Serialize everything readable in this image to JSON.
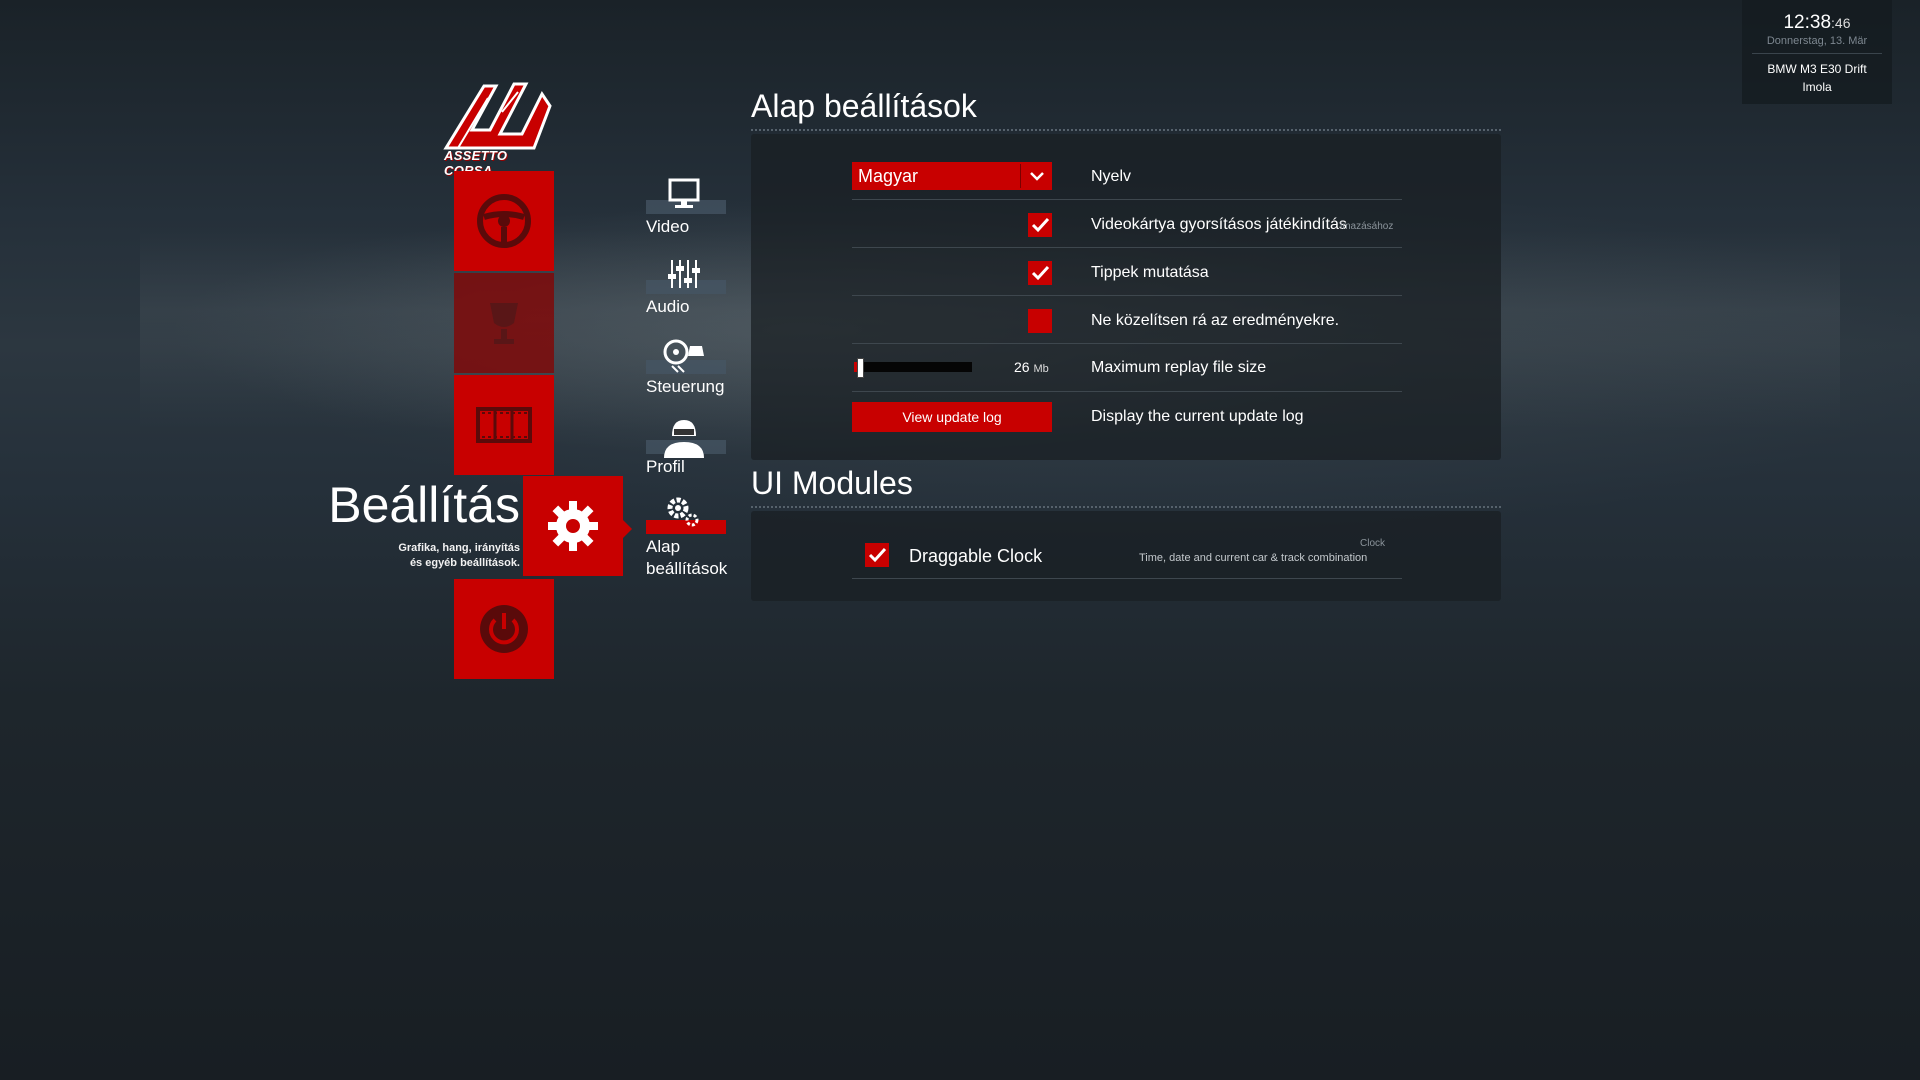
{
  "clock": {
    "time": "12:38",
    "seconds": ":46",
    "date": "Donnerstag, 13. Mär",
    "car": "BMW M3 E30 Drift",
    "track": "Imola"
  },
  "logo": {
    "text": "ASSETTO CORSA"
  },
  "main_menu": {
    "items": [
      {
        "icon": "steering-wheel-icon"
      },
      {
        "icon": "trophy-icon"
      },
      {
        "icon": "film-strip-icon"
      },
      {
        "icon": "gear-icon"
      },
      {
        "icon": "power-icon"
      }
    ],
    "active_title": "Beállítás",
    "active_subtitle_1": "Grafika, hang, irányítás",
    "active_subtitle_2": "és egyéb beállítások."
  },
  "submenu": {
    "items": [
      {
        "label": "Video",
        "icon": "monitor-icon"
      },
      {
        "label": "Audio",
        "icon": "mixer-icon"
      },
      {
        "label": "Steuerung",
        "icon": "controls-icon"
      },
      {
        "label": "Profil",
        "icon": "driver-icon"
      },
      {
        "label_1": "Alap",
        "label_2": "beállítások",
        "icon": "gears-icon",
        "active": true
      }
    ]
  },
  "general": {
    "title": "Alap beállítások",
    "language": {
      "value": "Magyar",
      "label": "Nyelv"
    },
    "gpu_accel": {
      "checked": true,
      "label": "Videokártya gyorsításos játékindítás",
      "suffix": "lmazásához"
    },
    "show_tips": {
      "checked": true,
      "label": "Tippek mutatása"
    },
    "no_zoom": {
      "checked": false,
      "label": "Ne közelítsen rá az eredményekre."
    },
    "replay_size": {
      "value": "26",
      "unit": "Mb",
      "fraction": 0.04,
      "label": "Maximum replay file size"
    },
    "update_log": {
      "button": "View update log",
      "label": "Display the current update log"
    }
  },
  "ui_modules": {
    "title": "UI Modules",
    "items": [
      {
        "checked": true,
        "name": "Draggable Clock",
        "category": "Clock",
        "description": "Time, date and current car & track combination"
      }
    ]
  },
  "colors": {
    "accent": "#c80000",
    "panel": "#191e22"
  }
}
